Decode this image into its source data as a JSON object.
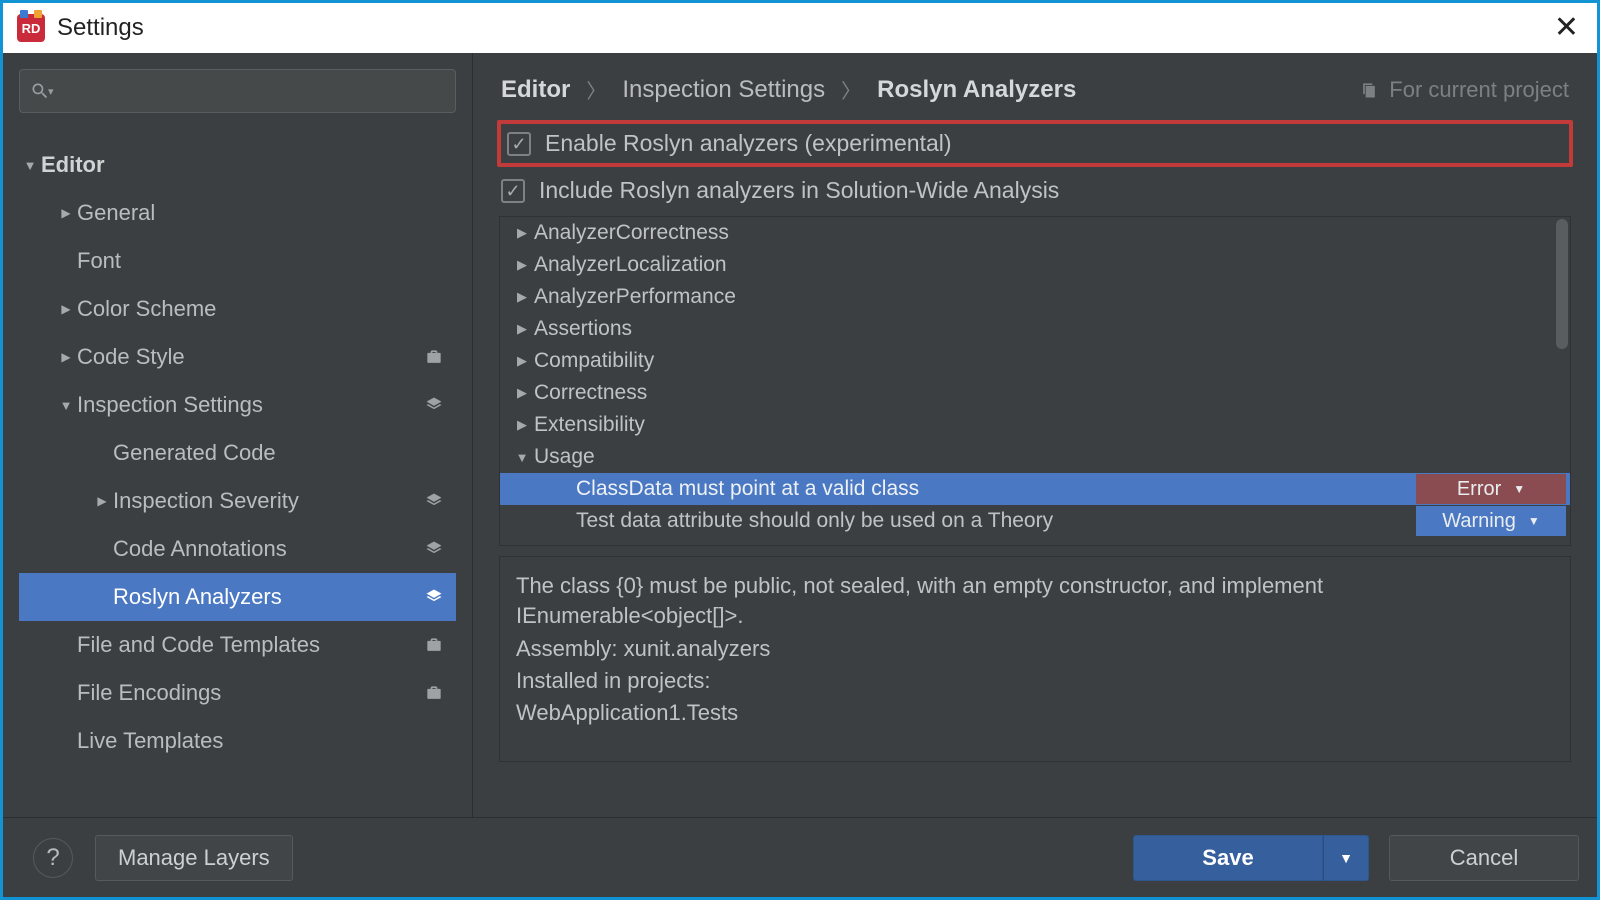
{
  "window": {
    "title": "Settings"
  },
  "sidebar": {
    "search_placeholder": "",
    "items": {
      "editor": "Editor",
      "general": "General",
      "font": "Font",
      "color_scheme": "Color Scheme",
      "code_style": "Code Style",
      "inspection_settings": "Inspection Settings",
      "generated_code": "Generated Code",
      "inspection_severity": "Inspection Severity",
      "code_annotations": "Code Annotations",
      "roslyn_analyzers": "Roslyn Analyzers",
      "file_code_templates": "File and Code Templates",
      "file_encodings": "File Encodings",
      "live_templates": "Live Templates"
    }
  },
  "breadcrumb": {
    "a": "Editor",
    "b": "Inspection Settings",
    "c": "Roslyn Analyzers",
    "scope": "For current project"
  },
  "checks": {
    "enable": "Enable Roslyn analyzers (experimental)",
    "include_swa": "Include Roslyn analyzers in Solution-Wide Analysis"
  },
  "tree": {
    "n0": "AnalyzerCorrectness",
    "n1": "AnalyzerLocalization",
    "n2": "AnalyzerPerformance",
    "n3": "Assertions",
    "n4": "Compatibility",
    "n5": "Correctness",
    "n6": "Extensibility",
    "n7": "Usage",
    "leaf0": "ClassData must point at a valid class",
    "leaf0_sev": "Error",
    "leaf1": "Test data attribute should only be used on a Theory",
    "leaf1_sev": "Warning"
  },
  "desc": {
    "l0": "The class {0} must be public, not sealed, with an empty constructor, and implement IEnumerable<object[]>.",
    "l1": "Assembly: xunit.analyzers",
    "l2": "Installed in projects:",
    "l3": " WebApplication1.Tests"
  },
  "footer": {
    "manage": "Manage Layers",
    "save": "Save",
    "cancel": "Cancel"
  }
}
